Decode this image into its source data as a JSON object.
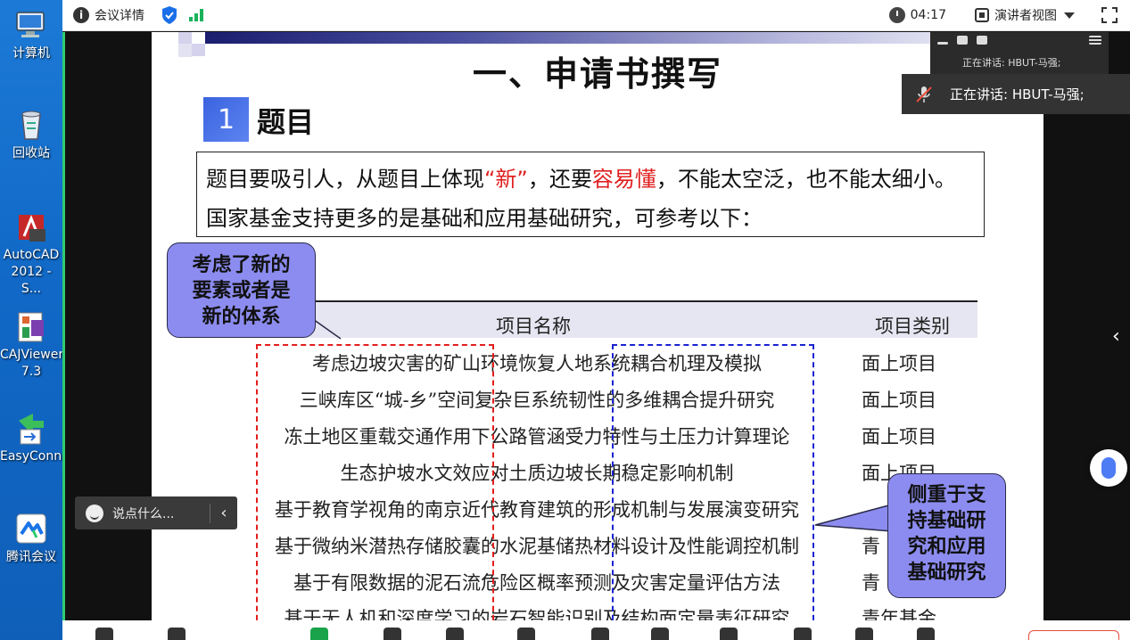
{
  "desktop": {
    "icons": [
      {
        "label": "计算机",
        "icon": "computer-icon"
      },
      {
        "label": "回收站",
        "icon": "recycle-bin-icon"
      },
      {
        "label": "AutoCAD 2012 - S...",
        "icon": "autocad-icon"
      },
      {
        "label": "CAJViewer 7.3",
        "icon": "cajviewer-icon"
      },
      {
        "label": "EasyConn...",
        "icon": "easyconnect-icon"
      },
      {
        "label": "腾讯会议",
        "icon": "tencent-meeting-icon"
      }
    ]
  },
  "topbar": {
    "meeting_info": "会议详情",
    "timer": "04:17",
    "view_mode": "演讲者视图"
  },
  "slide": {
    "title": "一、申请书撰写",
    "section_number": "1",
    "section_title": "题目",
    "intro": {
      "part1": "题目要吸引人，从题目上体现",
      "highlight1": "“新”",
      "part2": "，还要",
      "highlight2": "容易懂",
      "part3": "，不能太空泛，也不能太细小。国家基金支持更多的是基础和应用基础研究，可参考以下："
    },
    "table": {
      "headers": [
        "项目名称",
        "项目类别"
      ],
      "rows": [
        {
          "name": "考虑边坡灾害的矿山环境恢复人地系统耦合机理及模拟",
          "category": "面上项目"
        },
        {
          "name": "三峡库区“城-乡”空间复杂巨系统韧性的多维耦合提升研究",
          "category": "面上项目"
        },
        {
          "name": "冻土地区重载交通作用下公路管涵受力特性与土压力计算理论",
          "category": "面上项目"
        },
        {
          "name": "生态护坡水文效应对土质边坡长期稳定影响机制",
          "category": "面上项目"
        },
        {
          "name": "基于教育学视角的南京近代教育建筑的形成机制与发展演变研究",
          "category": ""
        },
        {
          "name": "基于微纳米潜热存储胶囊的水泥基储热材料设计及性能调控机制",
          "category": "青"
        },
        {
          "name": "基于有限数据的泥石流危险区概率预测及灾害定量评估方法",
          "category": "青"
        },
        {
          "name": "基于无人机和深度学习的岩石智能识别及结构面定量表征研究",
          "category": "青年基金"
        }
      ]
    },
    "callout_left": [
      "考虑了新的",
      "要素或者是",
      "新的体系"
    ],
    "callout_right": [
      "侧重于支",
      "持基础研",
      "究和应用",
      "基础研究"
    ]
  },
  "speaker_panel": {
    "small_label": "正在讲话:  HBUT-马强;",
    "popup_label": "正在讲话:  HBUT-马强;"
  },
  "chat": {
    "placeholder": "说点什么..."
  },
  "colors": {
    "accent_red": "#e02020",
    "dash_red": "#e31e1e",
    "dash_blue": "#1a22d0",
    "callout_fill": "#8c8cf0",
    "desktop_blue": "#1168c6",
    "signal_green": "#19b25a"
  }
}
